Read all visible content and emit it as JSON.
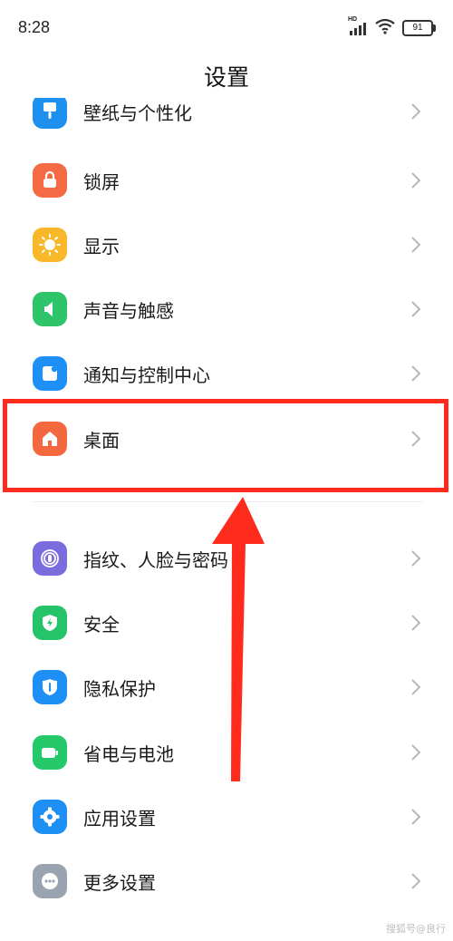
{
  "status_bar": {
    "time": "8:28",
    "network_label": "HD",
    "battery": "91"
  },
  "header": {
    "title": "设置"
  },
  "settings": {
    "wallpaper": "壁纸与个性化",
    "lock_screen": "锁屏",
    "display": "显示",
    "sound": "声音与触感",
    "notifications": "通知与控制中心",
    "home_screen": "桌面",
    "fingerprint": "指纹、人脸与密码",
    "security": "安全",
    "privacy": "隐私保护",
    "battery": "省电与电池",
    "apps": "应用设置",
    "more": "更多设置"
  },
  "colors": {
    "wallpaper": "#1e90f0",
    "lock_screen": "#f36a45",
    "display": "#f8b829",
    "sound": "#2ec46a",
    "notifications": "#1e8ff5",
    "home_screen": "#f4683f",
    "fingerprint": "#7b6cde",
    "security": "#26c46a",
    "privacy": "#1e8ff5",
    "battery": "#26c96a",
    "apps": "#1e8ff5",
    "more": "#9aa3b0",
    "annotation": "#ff2b1c"
  },
  "icons": {
    "wallpaper": "paintbrush-icon",
    "lock_screen": "lock-icon",
    "display": "sun-icon",
    "sound": "speaker-icon",
    "notifications": "notification-icon",
    "home_screen": "home-icon",
    "fingerprint": "fingerprint-icon",
    "security": "shield-icon",
    "privacy": "privacy-shield-icon",
    "battery": "battery-icon",
    "apps": "gear-icon",
    "more": "more-dots-icon"
  },
  "watermark": "搜狐号@良行"
}
